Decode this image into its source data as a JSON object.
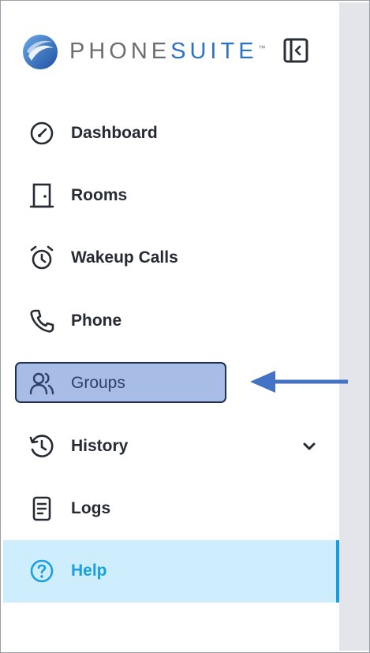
{
  "brand": {
    "name_part1": "PHONE",
    "name_part2": "SUITE",
    "trademark": "™",
    "colors": {
      "gray": "#6d6e71",
      "blue": "#2f72c4"
    }
  },
  "header": {
    "collapse_icon": "sidebar-collapse-icon"
  },
  "nav": {
    "items": [
      {
        "id": "dashboard",
        "label": "Dashboard",
        "icon": "gauge-icon"
      },
      {
        "id": "rooms",
        "label": "Rooms",
        "icon": "door-icon"
      },
      {
        "id": "wakeup",
        "label": "Wakeup Calls",
        "icon": "alarm-clock-icon"
      },
      {
        "id": "phone",
        "label": "Phone",
        "icon": "phone-icon"
      },
      {
        "id": "groups",
        "label": "Groups",
        "icon": "users-icon",
        "highlighted": true
      },
      {
        "id": "history",
        "label": "History",
        "icon": "history-icon",
        "expandable": true
      },
      {
        "id": "logs",
        "label": "Logs",
        "icon": "document-icon"
      },
      {
        "id": "help",
        "label": "Help",
        "icon": "help-circle-icon",
        "active": true
      }
    ]
  },
  "annotation": {
    "arrow_color": "#4472c4",
    "highlight_fill": "#a7bde5",
    "active_color": "#1d9be3"
  }
}
